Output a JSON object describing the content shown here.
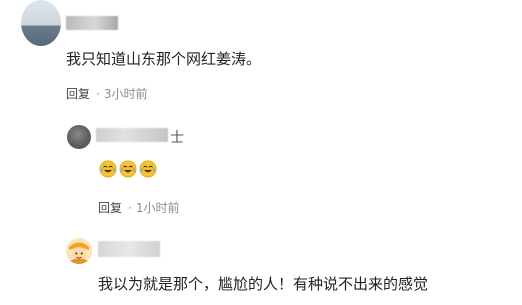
{
  "comments": [
    {
      "text": "我只知道山东那个网红姜涛。",
      "reply_label": "回复",
      "separator": "·",
      "time": "3小时前"
    },
    {
      "name_suffix": "士",
      "emojis": [
        "crying-laugh-emoji",
        "crying-laugh-emoji",
        "crying-laugh-emoji"
      ],
      "reply_label": "回复",
      "separator": "·",
      "time": "1小时前"
    },
    {
      "text": "我以为就是那个，尴尬的人！有种说不出来的感觉"
    }
  ]
}
